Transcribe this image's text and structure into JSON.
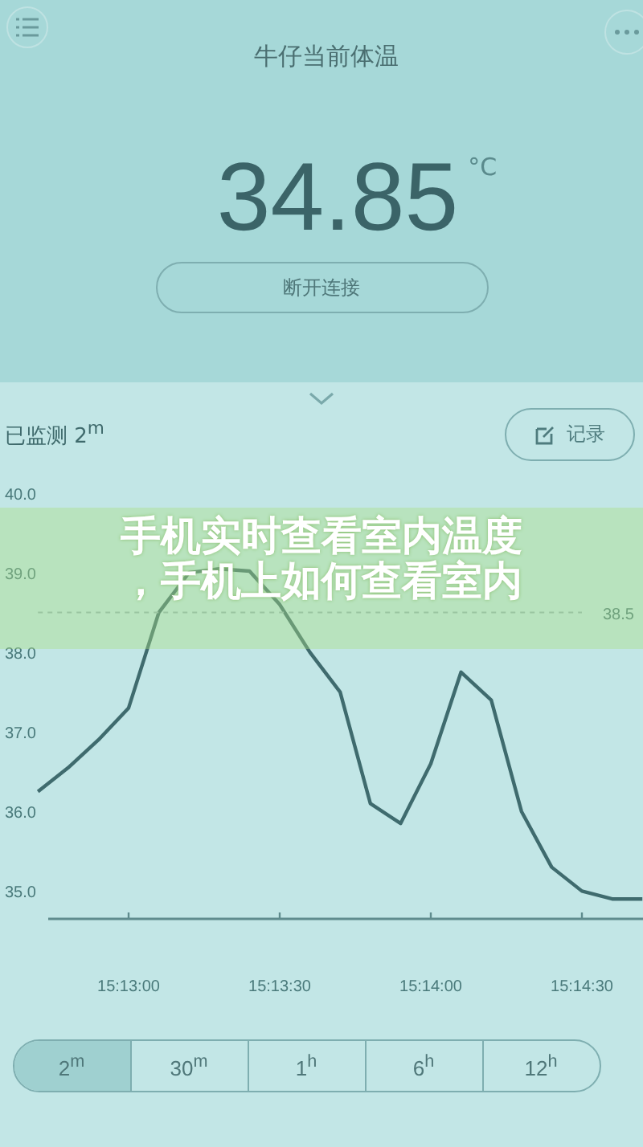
{
  "header": {
    "title": "牛仔当前体温"
  },
  "reading": {
    "value": "34.85",
    "unit": "°C"
  },
  "disconnect_button": "断开连接",
  "monitor": {
    "label": "已监测 2$^{m}$",
    "record_button": "记录"
  },
  "chart": {
    "reference_label": "38.5",
    "chart_data": {
      "type": "line",
      "categories": [
        null,
        null,
        null,
        "15:13:00",
        null,
        null,
        null,
        null,
        "15:13:30",
        null,
        null,
        null,
        null,
        "15:14:00",
        null,
        null,
        null,
        null,
        "15:14:30",
        null,
        null
      ],
      "series": [
        {
          "color": "#3f6b6e",
          "values": [
            36.25,
            36.55,
            36.9,
            37.3,
            38.5,
            39.0,
            39.05,
            39.02,
            38.6,
            38.0,
            37.5,
            36.1,
            35.85,
            36.6,
            37.75,
            37.4,
            36.0,
            35.3,
            35.0,
            34.9,
            34.9
          ]
        },
        {
          "color": "#8fb5b6",
          "line_style": "dashed",
          "values": [
            38.5,
            38.5,
            38.5,
            38.5,
            38.5,
            38.5,
            38.5,
            38.5,
            38.5,
            38.5,
            38.5,
            38.5,
            38.5,
            38.5,
            38.5,
            38.5,
            38.5,
            38.5,
            38.5,
            null,
            null
          ]
        }
      ],
      "ylim": [
        34.65,
        40.0
      ],
      "yticks": [
        {
          "value": 35,
          "label": "35.0"
        },
        {
          "value": 36,
          "label": "36.0"
        },
        {
          "value": 37,
          "label": "37.0"
        },
        {
          "value": 38,
          "label": "38.0"
        },
        {
          "value": 39,
          "label": "39.0"
        },
        {
          "value": 40,
          "label": "40.0"
        }
      ]
    }
  },
  "ranges": [
    {
      "label": "2$^{m}$",
      "selected": true
    },
    {
      "label": "30$^{m}$",
      "selected": false
    },
    {
      "label": "1$^{h}$",
      "selected": false
    },
    {
      "label": "6$^{h}$",
      "selected": false
    },
    {
      "label": "12$^{h}$",
      "selected": false
    }
  ],
  "banner": {
    "lines": [
      "手机实时查看室内温度",
      "，手机上如何查看室内"
    ]
  }
}
